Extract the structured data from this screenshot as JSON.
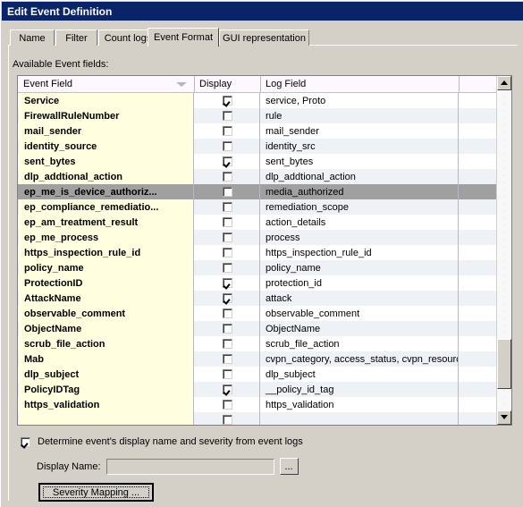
{
  "window": {
    "title": "Edit Event Definition"
  },
  "tabs": [
    {
      "label": "Name",
      "active": false
    },
    {
      "label": "Filter",
      "active": false
    },
    {
      "label": "Count logs",
      "active": false
    },
    {
      "label": "Event Format",
      "active": true
    },
    {
      "label": "GUI representation",
      "active": false
    }
  ],
  "section": {
    "available_fields_label": "Available Event fields:"
  },
  "list": {
    "columns": [
      "Event Field",
      "Display",
      "Log Field",
      ""
    ],
    "sort_column": "Event Field",
    "rows": [
      {
        "field": "Service",
        "display": true,
        "log": "service, Proto",
        "selected": false
      },
      {
        "field": "FirewallRuleNumber",
        "display": false,
        "log": "rule",
        "selected": false
      },
      {
        "field": "mail_sender",
        "display": false,
        "log": "mail_sender",
        "selected": false
      },
      {
        "field": "identity_source",
        "display": false,
        "log": "identity_src",
        "selected": false
      },
      {
        "field": "sent_bytes",
        "display": true,
        "log": "sent_bytes",
        "selected": false
      },
      {
        "field": "dlp_addtional_action",
        "display": false,
        "log": "dlp_addtional_action",
        "selected": false
      },
      {
        "field": "ep_me_is_device_authoriz...",
        "display": false,
        "log": "media_authorized",
        "selected": true
      },
      {
        "field": "ep_compliance_remediatio...",
        "display": false,
        "log": "remediation_scope",
        "selected": false
      },
      {
        "field": "ep_am_treatment_result",
        "display": false,
        "log": "action_details",
        "selected": false
      },
      {
        "field": "ep_me_process",
        "display": false,
        "log": "process",
        "selected": false
      },
      {
        "field": "https_inspection_rule_id",
        "display": false,
        "log": "https_inspection_rule_id",
        "selected": false
      },
      {
        "field": "policy_name",
        "display": false,
        "log": "policy_name",
        "selected": false
      },
      {
        "field": "ProtectionID",
        "display": true,
        "log": "protection_id",
        "selected": false
      },
      {
        "field": "AttackName",
        "display": true,
        "log": "attack",
        "selected": false
      },
      {
        "field": "observable_comment",
        "display": false,
        "log": "observable_comment",
        "selected": false
      },
      {
        "field": "ObjectName",
        "display": false,
        "log": "ObjectName",
        "selected": false
      },
      {
        "field": "scrub_file_action",
        "display": false,
        "log": "scrub_file_action",
        "selected": false
      },
      {
        "field": "Mab",
        "display": false,
        "log": "cvpn_category, access_status, cvpn_resource,",
        "selected": false
      },
      {
        "field": "dlp_subject",
        "display": false,
        "log": "dlp_subject",
        "selected": false
      },
      {
        "field": "PolicyIDTag",
        "display": true,
        "log": "__policy_id_tag",
        "selected": false
      },
      {
        "field": "https_validation",
        "display": false,
        "log": "https_validation",
        "selected": false
      },
      {
        "field": "",
        "display": false,
        "log": "",
        "selected": false
      }
    ]
  },
  "scrollbar": {
    "up_icon": "scroll-up-arrow",
    "down_icon": "scroll-down-arrow"
  },
  "footer": {
    "determine_checkbox_label": "Determine event's display name and severity from event logs",
    "determine_checked": true,
    "display_name_label": "Display Name:",
    "display_name_value": "",
    "display_name_placeholder": "",
    "browse_button_label": "...",
    "severity_mapping_button_label": "Severity Mapping ..."
  },
  "colors": {
    "titlebar": "#0a246a",
    "dialog_face": "#d4d0c8",
    "field_column": "#ffffe0",
    "selection": "#a0a0a0",
    "alt_row": "#eef1f6"
  }
}
